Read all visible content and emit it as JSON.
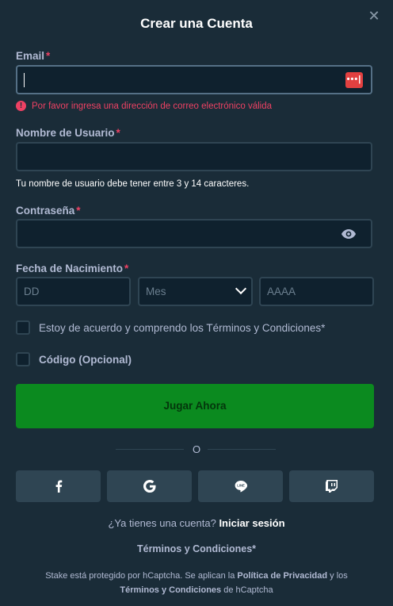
{
  "modal": {
    "title": "Crear una Cuenta",
    "close_icon": "close-icon"
  },
  "email": {
    "label": "Email",
    "required_mark": "*",
    "value": "",
    "error": "Por favor ingresa una dirección de correo electrónico válida",
    "password_manager_icon": "•••|"
  },
  "username": {
    "label": "Nombre de Usuario",
    "required_mark": "*",
    "value": "",
    "hint": "Tu nombre de usuario debe tener entre 3 y 14 caracteres."
  },
  "password": {
    "label": "Contraseña",
    "required_mark": "*",
    "value": ""
  },
  "birthdate": {
    "label": "Fecha de Nacimiento",
    "required_mark": "*",
    "day_placeholder": "DD",
    "month_selected": "Mes",
    "year_placeholder": "AAAA"
  },
  "checkboxes": {
    "terms": "Estoy de acuerdo y comprendo los Términos y Condiciones*",
    "code": "Código (Opcional)"
  },
  "play_button": "Jugar Ahora",
  "divider_text": "O",
  "social": [
    "facebook-icon",
    "google-icon",
    "line-icon",
    "twitch-icon"
  ],
  "account": {
    "question": "¿Ya tienes una cuenta?",
    "login_link": "Iniciar sesión"
  },
  "terms_link": "Términos y Condiciones*",
  "captcha": {
    "part1": "Stake está protegido por hCaptcha. Se aplican la ",
    "privacy": "Política de Privacidad",
    "part2": " y los",
    "terms": "Términos y Condiciones",
    "part3": " de hCaptcha"
  },
  "colors": {
    "background": "#1a2c38",
    "input_bg": "#0f212e",
    "border": "#2f4553",
    "error": "#ed4163",
    "play_button": "#0b8a1f"
  }
}
